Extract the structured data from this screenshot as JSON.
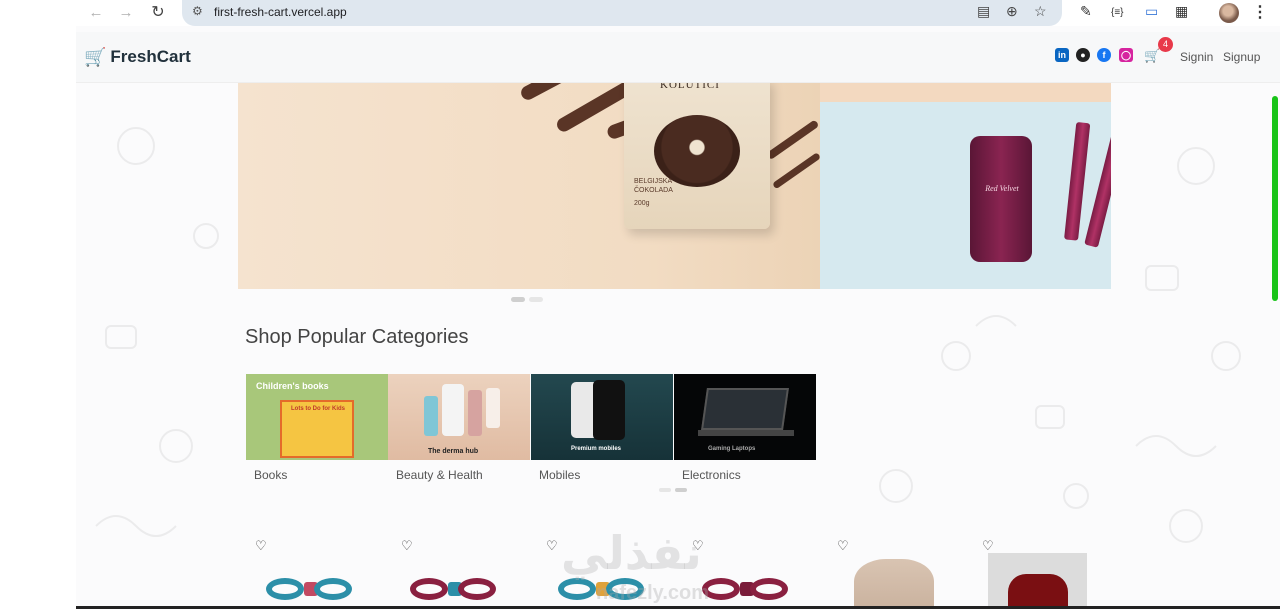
{
  "browser": {
    "url": "first-fresh-cart.vercel.app",
    "back_icon": "arrow-left-icon",
    "forward_icon": "arrow-right-icon",
    "reload_icon": "reload-icon"
  },
  "navbar": {
    "brand": "FreshCart",
    "cart_count": "4",
    "signin_label": "Signin",
    "signup_label": "Signup",
    "social_icons": [
      "linkedin-icon",
      "github-icon",
      "facebook-icon",
      "instagram-icon"
    ]
  },
  "slider": {
    "bag_title": "KOLUTICI",
    "bag_subtitle": "BELGIJSKA ČOKOLADA",
    "bag_weight": "200g",
    "can_label": "Red Velvet"
  },
  "categories": {
    "title": "Shop Popular Categories",
    "items": [
      {
        "name": "Books",
        "caption": "Children's books",
        "inner": "Lots to Do for Kids"
      },
      {
        "name": "Beauty & Health",
        "caption": "The derma hub"
      },
      {
        "name": "Mobiles",
        "caption": "Premium mobiles"
      },
      {
        "name": "Electronics",
        "caption": "Gaming Laptops"
      }
    ]
  },
  "watermark": {
    "arabic": "نفذلي",
    "latin": "nafezly.com"
  },
  "colors": {
    "brand": "#0aad0a",
    "badge": "#e8394a",
    "scrollbar": "#18c418"
  }
}
